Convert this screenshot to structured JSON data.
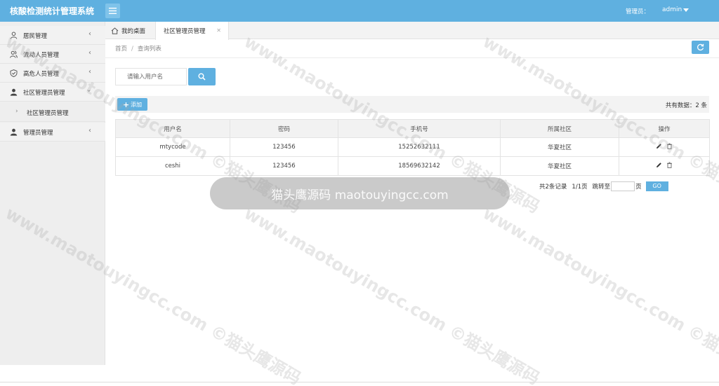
{
  "header": {
    "app_title": "核酸检测统计管理系统",
    "admin_label": "管理员：",
    "admin_user": "admin"
  },
  "sidebar": {
    "items": [
      {
        "label": "居民管理",
        "icon": "user-outline-icon"
      },
      {
        "label": "流动人员管理",
        "icon": "users-outline-icon"
      },
      {
        "label": "高危人员管理",
        "icon": "shield-icon"
      },
      {
        "label": "社区管理员管理",
        "icon": "user-filled-icon"
      },
      {
        "label": "管理员管理",
        "icon": "user-filled-icon"
      }
    ],
    "sub_items": [
      {
        "label": "社区管理员管理"
      }
    ]
  },
  "tabs": [
    {
      "label": "我的桌面"
    },
    {
      "label": "社区管理员管理"
    }
  ],
  "breadcrumb": {
    "home": "首页",
    "separator": "/",
    "current": "查询列表"
  },
  "search": {
    "placeholder": "请输入用户名"
  },
  "toolbar": {
    "add_label": "添加",
    "total_text": "共有数据：2 条"
  },
  "table": {
    "columns": [
      "用户名",
      "密码",
      "手机号",
      "所属社区",
      "操作"
    ],
    "rows": [
      {
        "username": "mtycode",
        "password": "123456",
        "phone": "15252632111",
        "community": "华夏社区"
      },
      {
        "username": "ceshi",
        "password": "123456",
        "phone": "18569632142",
        "community": "华夏社区"
      }
    ]
  },
  "pager": {
    "records": "共2条记录",
    "pages": "1/1页",
    "jump_label": "跳转至",
    "page_unit": "页",
    "go_label": "GO"
  },
  "watermark": {
    "banner": "猫头鹰源码 maotouyingcc.com",
    "tile": "www.maotouyingcc.com ©猫头鹰源码"
  },
  "colors": {
    "primary": "#5fb0e0",
    "sidebar_bg": "#eeeeee"
  }
}
